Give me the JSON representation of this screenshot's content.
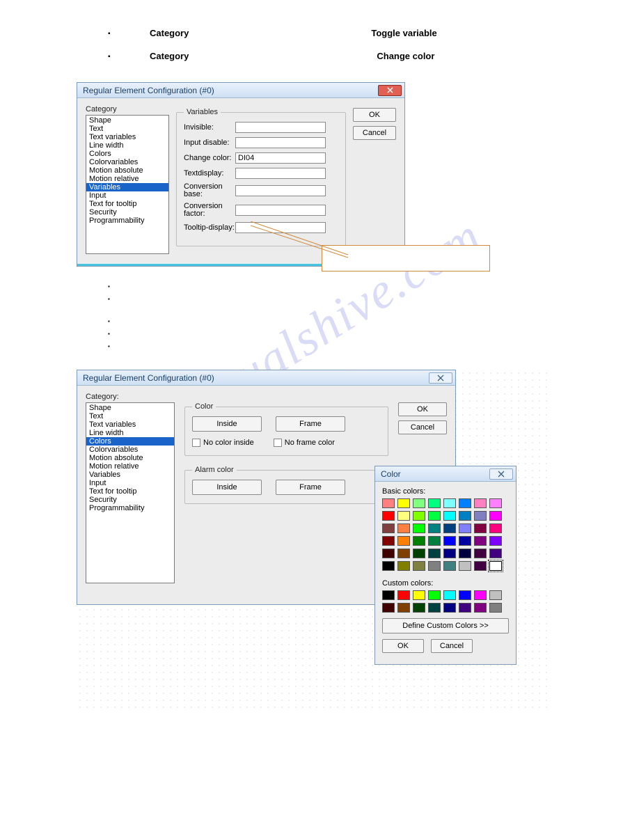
{
  "watermark": "manualshive.com",
  "header_rows": [
    {
      "label": "Category",
      "value": "Toggle variable"
    },
    {
      "label": "Category",
      "value": "Change color"
    }
  ],
  "dialog1": {
    "title": "Regular Element Configuration (#0)",
    "category_label": "Category",
    "categories": [
      "Shape",
      "Text",
      "Text variables",
      "Line width",
      "Colors",
      "Colorvariables",
      "Motion absolute",
      "Motion relative",
      "Variables",
      "Input",
      "Text for tooltip",
      "Security",
      "Programmability"
    ],
    "selected_category": "Variables",
    "fieldset_label": "Variables",
    "fields": {
      "invisible": {
        "label": "Invisible:",
        "value": ""
      },
      "input_disable": {
        "label": "Input disable:",
        "value": ""
      },
      "change_color": {
        "label": "Change color:",
        "value": "DI04"
      },
      "textdisplay": {
        "label": "Textdisplay:",
        "value": ""
      },
      "conv_base": {
        "label": "Conversion base:",
        "value": ""
      },
      "conv_factor": {
        "label": "Conversion factor:",
        "value": ""
      },
      "tooltip": {
        "label": "Tooltip-display:",
        "value": ""
      }
    },
    "ok": "OK",
    "cancel": "Cancel"
  },
  "dialog2": {
    "title": "Regular Element Configuration (#0)",
    "category_label": "Category:",
    "categories": [
      "Shape",
      "Text",
      "Text variables",
      "Line width",
      "Colors",
      "Colorvariables",
      "Motion absolute",
      "Motion relative",
      "Variables",
      "Input",
      "Text for tooltip",
      "Security",
      "Programmability"
    ],
    "selected_category": "Colors",
    "color_group": "Color",
    "alarm_group": "Alarm color",
    "inside": "Inside",
    "frame": "Frame",
    "no_color_inside": "No color inside",
    "no_frame_color": "No frame color",
    "ok": "OK",
    "cancel": "Cancel"
  },
  "colordlg": {
    "title": "Color",
    "basic_label": "Basic colors:",
    "custom_label": "Custom colors:",
    "define": "Define Custom Colors >>",
    "ok": "OK",
    "cancel": "Cancel",
    "basic_colors": [
      "#ff8080",
      "#ffff00",
      "#80ff80",
      "#00ff80",
      "#80ffff",
      "#0080ff",
      "#ff80c0",
      "#ff80ff",
      "#ff0000",
      "#ffff80",
      "#80ff00",
      "#00ff40",
      "#00ffff",
      "#0080c0",
      "#8080c0",
      "#ff00ff",
      "#804040",
      "#ff8040",
      "#00ff00",
      "#008080",
      "#004080",
      "#8080ff",
      "#800040",
      "#ff0080",
      "#800000",
      "#ff8000",
      "#008000",
      "#008040",
      "#0000ff",
      "#0000a0",
      "#800080",
      "#8000ff",
      "#400000",
      "#804000",
      "#004000",
      "#004040",
      "#000080",
      "#000040",
      "#400040",
      "#400080",
      "#000000",
      "#808000",
      "#808040",
      "#808080",
      "#408080",
      "#c0c0c0",
      "#400040",
      "#ffffff"
    ],
    "custom_colors": [
      "#000000",
      "#ff0000",
      "#ffff00",
      "#00ff00",
      "#00ffff",
      "#0000ff",
      "#ff00ff",
      "#c0c0c0",
      "#400000",
      "#804000",
      "#004000",
      "#004040",
      "#000080",
      "#400080",
      "#800080",
      "#808080"
    ]
  }
}
